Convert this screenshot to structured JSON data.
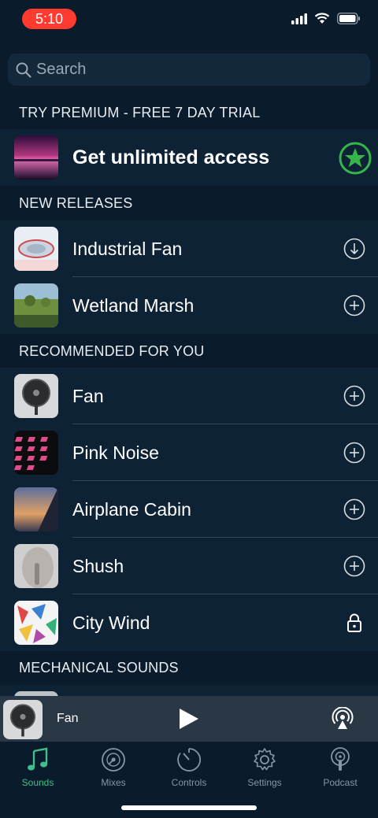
{
  "status_bar": {
    "time": "5:10"
  },
  "search": {
    "placeholder": "Search"
  },
  "sections": {
    "premium": "TRY PREMIUM - FREE 7 DAY TRIAL",
    "new_releases": "NEW RELEASES",
    "recommended": "RECOMMENDED FOR YOU",
    "mechanical": "MECHANICAL SOUNDS"
  },
  "premium_row": {
    "label": "Get unlimited access",
    "icon": "star-icon"
  },
  "new_releases": [
    {
      "label": "Industrial Fan",
      "action": "download-icon"
    },
    {
      "label": "Wetland Marsh",
      "action": "add-icon"
    }
  ],
  "recommended": [
    {
      "label": "Fan",
      "action": "add-icon"
    },
    {
      "label": "Pink Noise",
      "action": "add-icon"
    },
    {
      "label": "Airplane Cabin",
      "action": "add-icon"
    },
    {
      "label": "Shush",
      "action": "add-icon"
    },
    {
      "label": "City Wind",
      "action": "lock-icon"
    }
  ],
  "player": {
    "title": "Fan"
  },
  "tabs": [
    {
      "label": "Sounds",
      "icon": "music-note-icon",
      "active": true
    },
    {
      "label": "Mixes",
      "icon": "disc-icon",
      "active": false
    },
    {
      "label": "Controls",
      "icon": "timer-icon",
      "active": false
    },
    {
      "label": "Settings",
      "icon": "gear-icon",
      "active": false
    },
    {
      "label": "Podcast",
      "icon": "podcast-icon",
      "active": false
    }
  ],
  "colors": {
    "background": "#0a1b2c",
    "row": "#0e2235",
    "accent": "#3fc08a",
    "status_pill": "#ff3b30"
  }
}
